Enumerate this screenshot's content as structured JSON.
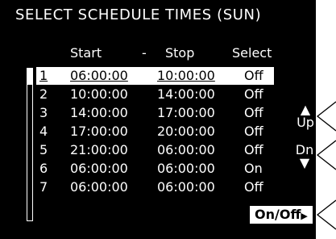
{
  "title": "SELECT SCHEDULE TIMES  (SUN)",
  "columns": {
    "start": "Start",
    "dash": "-",
    "stop": "Stop",
    "select": "Select"
  },
  "rows": [
    {
      "idx": "1",
      "start": "06:00:00",
      "stop": "10:00:00",
      "select": "Off",
      "selected": true
    },
    {
      "idx": "2",
      "start": "10:00:00",
      "stop": "14:00:00",
      "select": "Off"
    },
    {
      "idx": "3",
      "start": "14:00:00",
      "stop": "17:00:00",
      "select": "Off"
    },
    {
      "idx": "4",
      "start": "17:00:00",
      "stop": "20:00:00",
      "select": "Off"
    },
    {
      "idx": "5",
      "start": "21:00:00",
      "stop": "06:00:00",
      "select": "Off"
    },
    {
      "idx": "6",
      "start": "06:00:00",
      "stop": "06:00:00",
      "select": "On"
    },
    {
      "idx": "7",
      "start": "06:00:00",
      "stop": "06:00:00",
      "select": "Off"
    }
  ],
  "softkeys": {
    "up_arrow": "▲",
    "up_label": "Up",
    "down_label": "Dn",
    "down_arrow": "▼",
    "onoff_label": "On/Off",
    "onoff_arrow": "▶"
  },
  "colors": {
    "screen_bg": "#000000",
    "text": "#ffffff",
    "highlight": "#ffffff"
  }
}
